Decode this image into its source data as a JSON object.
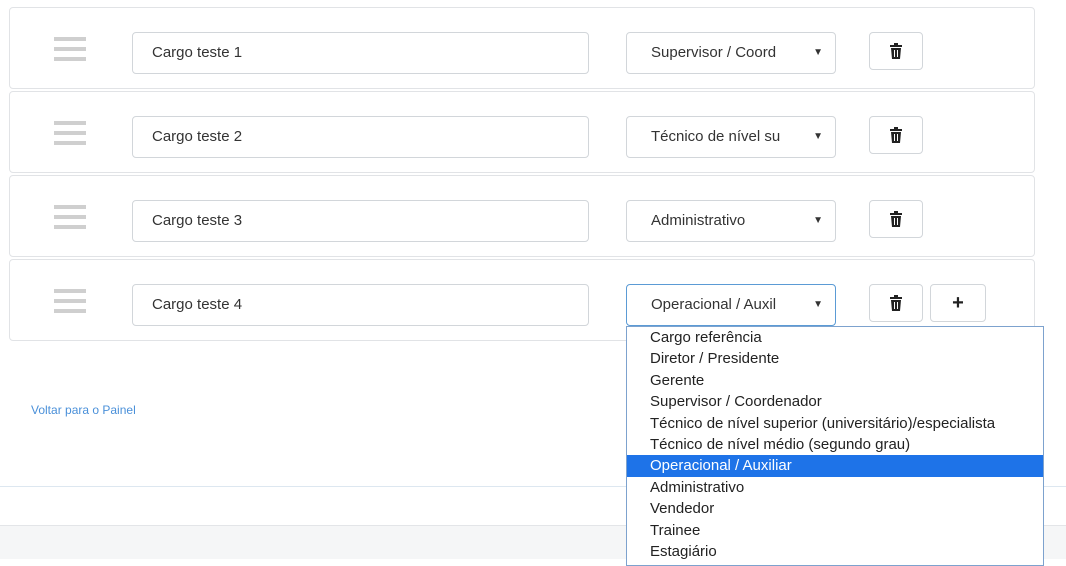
{
  "rows": [
    {
      "name": "Cargo teste 1",
      "category": "Supervisor / Coordenador",
      "category_display": "Supervisor / Coord"
    },
    {
      "name": "Cargo teste 2",
      "category": "Técnico de nível superior (universitário)/especialista",
      "category_display": "Técnico de nível su"
    },
    {
      "name": "Cargo teste 3",
      "category": "Administrativo",
      "category_display": "Administrativo"
    },
    {
      "name": "Cargo teste 4",
      "category": "Operacional / Auxiliar",
      "category_display": "Operacional / Auxil"
    }
  ],
  "dropdown": {
    "options": [
      "Cargo referência",
      "Diretor / Presidente",
      "Gerente",
      "Supervisor / Coordenador",
      "Técnico de nível superior (universitário)/especialista",
      "Técnico de nível médio (segundo grau)",
      "Operacional / Auxiliar",
      "Administrativo",
      "Vendedor",
      "Trainee",
      "Estagiário"
    ],
    "selected_index": 6
  },
  "icons": {
    "drag": "drag-handle-icon",
    "delete": "trash-icon",
    "add": "plus-icon",
    "select_arrow": "chevron-down-icon"
  },
  "labels": {
    "select_arrow_glyph": "▼",
    "add_glyph": "+"
  },
  "footer": {
    "back_link": "Voltar para o Painel"
  },
  "colors": {
    "link": "#4a90d9",
    "highlight": "#1e73e8",
    "focus_border": "#5b9bd5"
  }
}
